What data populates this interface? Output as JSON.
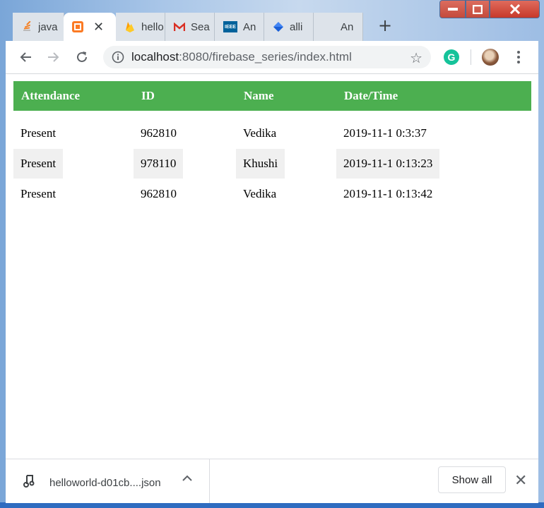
{
  "browser": {
    "tabs": [
      {
        "title": "java",
        "icon": "stackoverflow-icon",
        "active": false
      },
      {
        "title": "",
        "icon": "xampp-icon",
        "active": true
      },
      {
        "title": "hello",
        "icon": "firebase-icon",
        "active": false
      },
      {
        "title": "Sea",
        "icon": "gmail-icon",
        "active": false
      },
      {
        "title": "An",
        "icon": "ieee-icon",
        "active": false
      },
      {
        "title": "alli",
        "icon": "diamond-icon",
        "active": false
      },
      {
        "title": "An",
        "icon": "",
        "active": false
      }
    ],
    "new_tab_label": "+",
    "close_tab_glyph": "✕",
    "address": {
      "host": "localhost",
      "rest": ":8080/firebase_series/index.html"
    },
    "extension_label": "G",
    "window_controls": {
      "minimize": "—",
      "maximize": "☐",
      "close": "✕"
    }
  },
  "table": {
    "headers": [
      "Attendance",
      "ID",
      "Name",
      "Date/Time"
    ],
    "rows": [
      [
        "Present",
        "962810",
        "Vedika",
        "2019-11-1 0:3:37"
      ],
      [
        "Present",
        "978110",
        "Khushi",
        "2019-11-1 0:13:23"
      ],
      [
        "Present",
        "962810",
        "Vedika",
        "2019-11-1 0:13:42"
      ]
    ],
    "header_color": "#4caf50",
    "alt_row_color": "#f0f0f0"
  },
  "downloads": {
    "file_name": "helloworld-d01cb....json",
    "show_all_label": "Show all",
    "close_glyph": "✕"
  }
}
